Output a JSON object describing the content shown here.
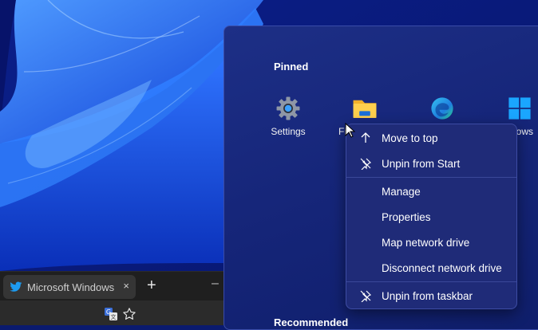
{
  "browser": {
    "tab_title": "Microsoft Windows /",
    "tab_icon": "twitter-bird-icon",
    "close_glyph": "×",
    "newtab_glyph": "+",
    "minimize_glyph": "–",
    "toolbar_icons": [
      "translate-icon",
      "favorite-star-icon"
    ],
    "accent": "#1d9bf0"
  },
  "start_menu": {
    "pinned_title": "Pinned",
    "recommended_title": "Recommended",
    "apps": [
      {
        "label": "Settings",
        "icon": "gear-icon"
      },
      {
        "label": "Fi",
        "icon": "file-explorer-folder-icon"
      },
      {
        "label": "",
        "icon": "edge-browser-icon"
      },
      {
        "label": "dows",
        "icon": "windows-logo-icon"
      }
    ]
  },
  "context_menu": {
    "items": [
      {
        "label": "Move to top",
        "icon": "arrow-up-icon"
      },
      {
        "label": "Unpin from Start",
        "icon": "unpin-icon"
      },
      {
        "label": "Manage",
        "icon": ""
      },
      {
        "label": "Properties",
        "icon": ""
      },
      {
        "label": "Map network drive",
        "icon": ""
      },
      {
        "label": "Disconnect network drive",
        "icon": ""
      },
      {
        "label": "Unpin from taskbar",
        "icon": "unpin-icon"
      }
    ]
  },
  "colors": {
    "start_bg": "#16267a",
    "menu_bg": "#1f2b78",
    "wallpaper_blue": "#1a5cff"
  }
}
